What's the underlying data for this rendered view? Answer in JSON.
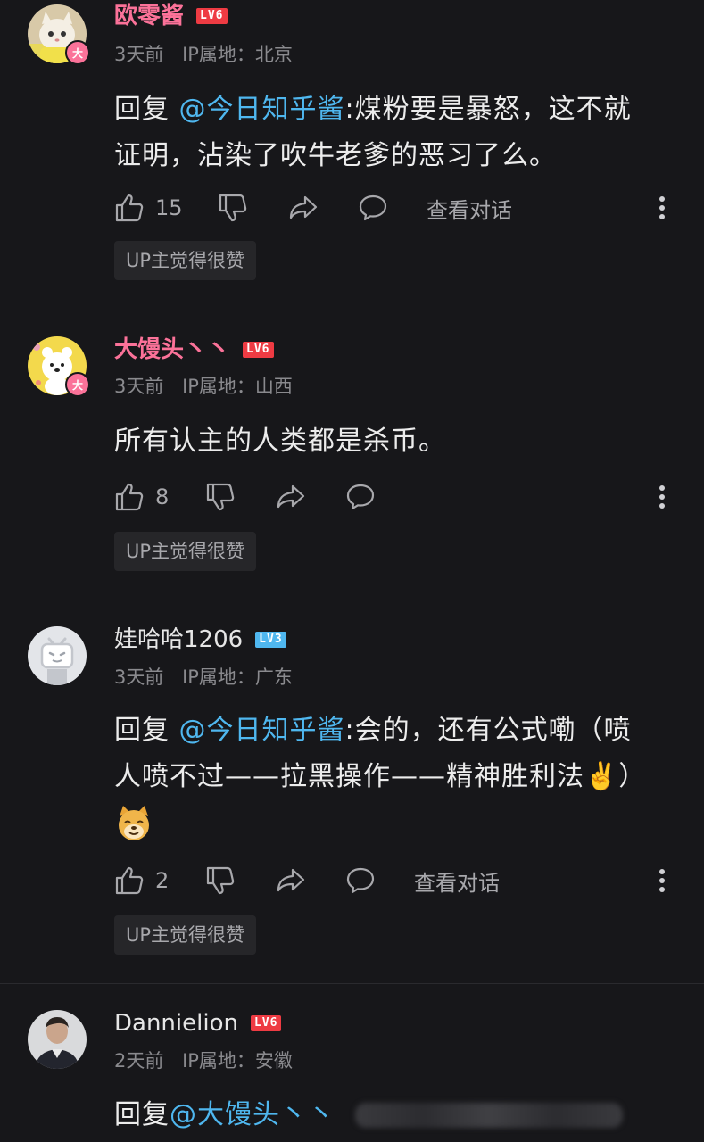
{
  "comments": [
    {
      "username": "欧零酱",
      "level": "LV6",
      "time": "3天前",
      "ip": "IP属地：北京",
      "reply_prefix": "回复 ",
      "mention": "@今日知乎酱",
      "text_1": ":煤粉要是暴怒，这不就",
      "text_2": "证明，沾染了吹牛老爹的恶习了么。",
      "likes": "15",
      "view_conversation": "查看对话",
      "tag": "UP主觉得很赞",
      "vip_badge": "大"
    },
    {
      "username": "大馒头丶丶",
      "level": "LV6",
      "time": "3天前",
      "ip": "IP属地：山西",
      "text_1": "所有认主的人类都是杀币。",
      "likes": "8",
      "tag": "UP主觉得很赞",
      "vip_badge": "大"
    },
    {
      "username": "娃哈哈1206",
      "level": "LV3",
      "time": "3天前",
      "ip": "IP属地：广东",
      "reply_prefix": "回复 ",
      "mention": "@今日知乎酱",
      "text_1": ":会的，还有公式嘞（喷",
      "text_2": "人喷不过——拉黑操作——精神胜利法✌️）",
      "likes": "2",
      "view_conversation": "查看对话",
      "tag": "UP主觉得很赞"
    },
    {
      "username": "Dannielion",
      "level": "LV6",
      "time": "2天前",
      "ip": "IP属地：安徽",
      "reply_prefix": "回复 ",
      "mention": "@大馒头丶丶"
    }
  ],
  "colors": {
    "background": "#17171a",
    "vip_name": "#fb7299",
    "mention": "#4fb7ef",
    "level6": "#ee3b43",
    "level3": "#4fb7ef"
  }
}
